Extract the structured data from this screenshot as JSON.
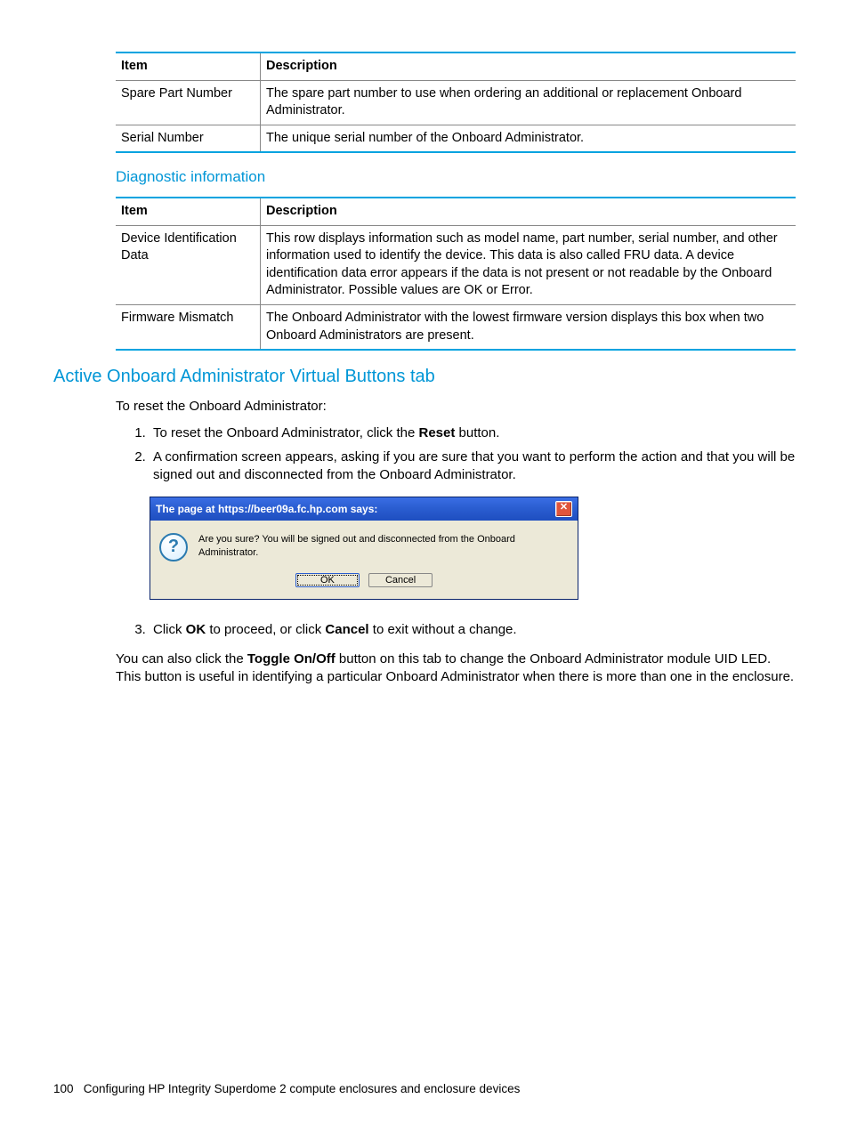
{
  "table1": {
    "headers": [
      "Item",
      "Description"
    ],
    "rows": [
      [
        "Spare Part Number",
        "The spare part number to use when ordering an additional or replacement Onboard Administrator."
      ],
      [
        "Serial Number",
        "The unique serial number of the Onboard Administrator."
      ]
    ]
  },
  "subheading1": "Diagnostic information",
  "table2": {
    "headers": [
      "Item",
      "Description"
    ],
    "rows": [
      [
        "Device Identification Data",
        "This row displays information such as model name, part number, serial number, and other information used to identify the device. This data is also called FRU data. A device identification data error appears if the data is not present or not readable by the Onboard Administrator. Possible values are OK or Error."
      ],
      [
        "Firmware Mismatch",
        "The Onboard Administrator with the lowest firmware version displays this box when two Onboard Administrators are present."
      ]
    ]
  },
  "section_heading": "Active Onboard Administrator Virtual Buttons tab",
  "intro_line": "To reset the Onboard Administrator:",
  "step1_pre": "To reset the Onboard Administrator, click the ",
  "step1_bold": "Reset",
  "step1_post": " button.",
  "step2": "A confirmation screen appears, asking if you are sure that you want to perform the action and that you will be signed out and disconnected from the Onboard Administrator.",
  "dialog": {
    "title": "The page at https://beer09a.fc.hp.com says:",
    "message": "Are you sure? You will be signed out and disconnected from the Onboard Administrator.",
    "ok": "OK",
    "cancel": "Cancel"
  },
  "step3_pre": "Click ",
  "step3_b1": "OK",
  "step3_mid": " to proceed, or click ",
  "step3_b2": "Cancel",
  "step3_post": " to exit without a change.",
  "para2_pre": "You can also click the ",
  "para2_bold": "Toggle On/Off",
  "para2_post": " button on this tab to change the Onboard Administrator module UID LED. This button is useful in identifying a particular Onboard Administrator when there is more than one in the enclosure.",
  "footer_page": "100",
  "footer_text": "Configuring HP Integrity Superdome 2 compute enclosures and enclosure devices"
}
